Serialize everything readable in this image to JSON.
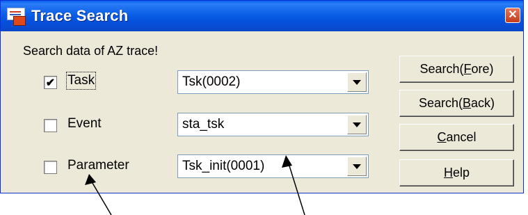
{
  "window": {
    "title": "Trace Search",
    "icon": "app-trace-icon",
    "close_glyph": "✕"
  },
  "prompt": "Search data of AZ trace!",
  "rows": [
    {
      "label": "Task",
      "checked": true,
      "value": "Tsk(0002)"
    },
    {
      "label": "Event",
      "checked": false,
      "value": "sta_tsk"
    },
    {
      "label": "Parameter",
      "checked": false,
      "value": "Tsk_init(0001)"
    }
  ],
  "buttons": {
    "search_fore": {
      "pre": "Search(",
      "key": "F",
      "post": "ore)"
    },
    "search_back": {
      "pre": "Search(",
      "key": "B",
      "post": "ack)"
    },
    "cancel": {
      "pre": "",
      "key": "C",
      "post": "ancel"
    },
    "help": {
      "pre": "",
      "key": "H",
      "post": "elp"
    }
  },
  "check_glyph": "✔",
  "colors": {
    "titlebar": "#0b5fe6",
    "window_bg": "#ece9d8",
    "close": "#c43c18"
  }
}
